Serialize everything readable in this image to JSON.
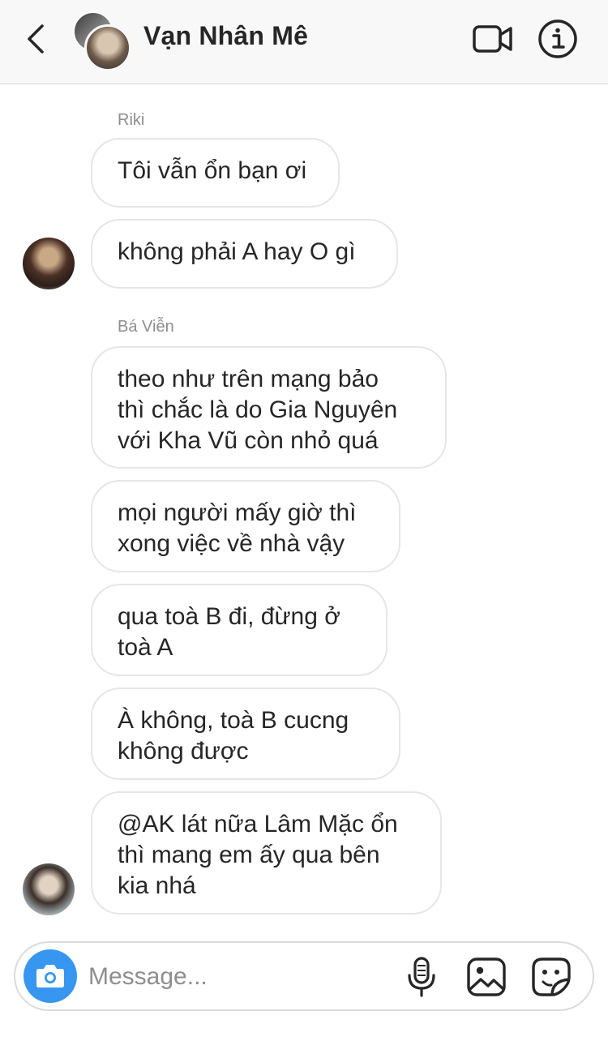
{
  "header": {
    "title": "Vạn Nhân Mê"
  },
  "composer": {
    "placeholder": "Message..."
  },
  "messages": [
    {
      "sender": "Riki",
      "lines": [
        "Tôi vẫn ổn bạn ơi",
        "không phải A hay O gì"
      ]
    },
    {
      "sender": "Bá Viễn",
      "lines": [
        "theo như trên mạng bảo\nthì chắc là do Gia Nguyên\nvới Kha Vũ còn nhỏ quá",
        "mọi người mấy giờ thì\nxong việc về nhà vậy",
        "qua toà B đi, đừng ở\ntoà A",
        "À không, toà B cucng\nkhông được",
        "@AK lát nữa Lâm Mặc ổn\nthì mang em ấy qua bên\nkia nhá"
      ]
    }
  ],
  "colors": {
    "accent": "#3797f0",
    "bubble_border": "#e6e6e6",
    "sender_name": "#8e8e8e",
    "header_bg": "#f8f8f8"
  },
  "icons": {
    "back": "chevron-left-icon",
    "video": "video-camera-icon",
    "info": "info-icon",
    "camera": "camera-icon",
    "mic": "microphone-icon",
    "gallery": "image-icon",
    "sticker": "sticker-icon"
  }
}
